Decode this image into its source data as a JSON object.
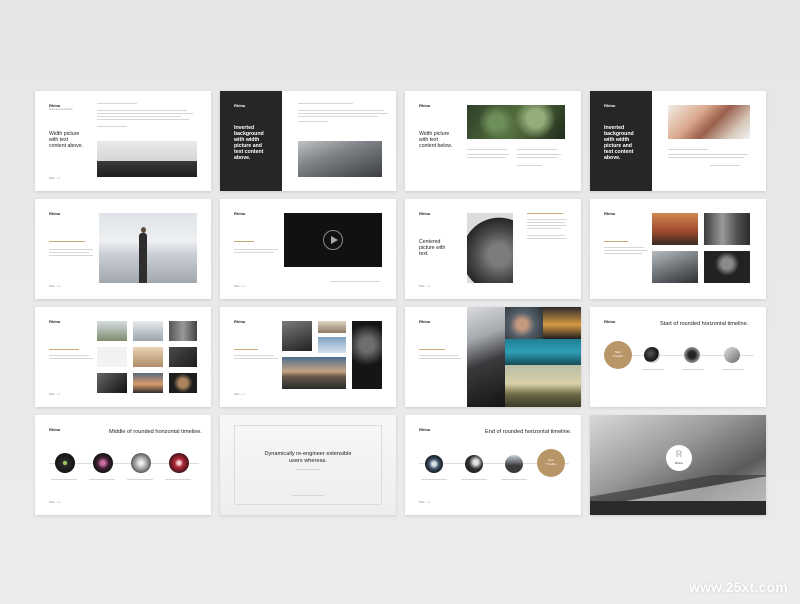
{
  "brand": {
    "name": "Rhinu",
    "sub": "Minimal presentation"
  },
  "page_label": "Slide — 1",
  "slides": {
    "s1": {
      "title": "Width picture\nwith text\ncontent above."
    },
    "s2": {
      "title": "Inverted\nbackground\nwith width\npicture and\ntext content\nabove."
    },
    "s3": {
      "title": "Width picture\nwith text\ncontent below."
    },
    "s4": {
      "title": "Inverted\nbackground\nwith width\npicture and\ntext content\nabove."
    },
    "s7": {
      "title": "Centered\npicture with\ntext."
    },
    "s12": {
      "title": "Start of rounded horizontal timeline.",
      "badge": "Start\nTimeline"
    },
    "s13": {
      "title": "Middle of rounded horizontal timeline."
    },
    "s14": {
      "title": "Dynamically re-engineer extensible\nusers whereas."
    },
    "s15": {
      "title": "End of rounded horizontal timeline.",
      "badge": "End\nTimeline"
    },
    "s16": {
      "logo_letter": "R",
      "logo_name": "Rhinu"
    }
  },
  "watermark": "www.25xt.com",
  "colors": {
    "accent": "#b89668",
    "dark": "#262626",
    "background": "#e9e9ea"
  },
  "icons": [
    "play-icon"
  ]
}
